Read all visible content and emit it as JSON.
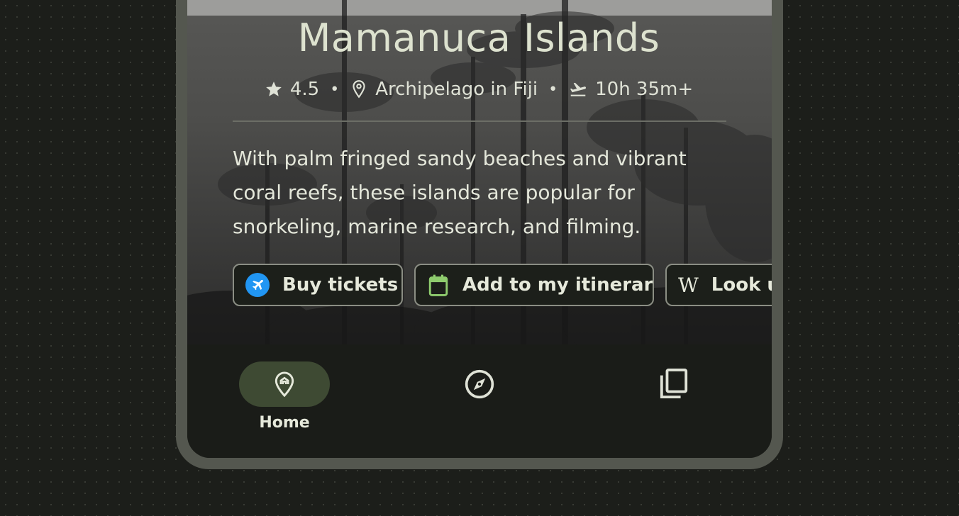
{
  "destination": {
    "title": "Mamanuca Islands",
    "rating": "4.5",
    "location": "Archipelago in Fiji",
    "flight_time": "10h 35m+",
    "description": "With palm fringed sandy beaches and vibrant coral reefs, these islands are popular for snorkeling, marine research, and filming."
  },
  "actions": {
    "buy_tickets": "Buy tickets",
    "add_itinerary": "Add to my itinerary",
    "look_up": "Look up"
  },
  "nav": {
    "home_label": "Home"
  },
  "icons": {
    "rating": "star-icon",
    "location": "location-pin-icon",
    "flight": "flight-takeoff-icon",
    "buy": "airplane-icon",
    "itinerary": "calendar-icon",
    "wiki": "wikipedia-icon",
    "home": "home-pin-icon",
    "explore": "compass-icon",
    "library": "copy-icon"
  },
  "colors": {
    "accent_green": "#8fcc6e",
    "airplane_blue": "#2196f3",
    "nav_pill": "#3e4a33",
    "text": "#dde2cf"
  }
}
